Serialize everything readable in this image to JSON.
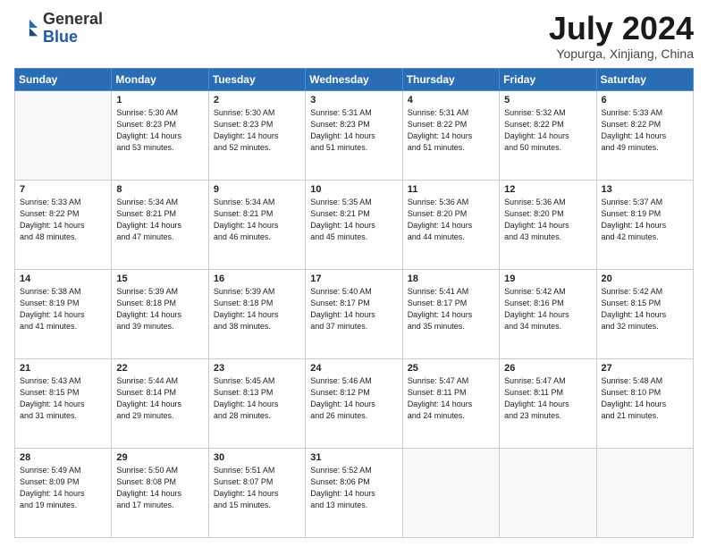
{
  "header": {
    "logo_general": "General",
    "logo_blue": "Blue",
    "title": "July 2024",
    "subtitle": "Yopurga, Xinjiang, China"
  },
  "calendar": {
    "days_of_week": [
      "Sunday",
      "Monday",
      "Tuesday",
      "Wednesday",
      "Thursday",
      "Friday",
      "Saturday"
    ],
    "weeks": [
      [
        {
          "day": "",
          "info": ""
        },
        {
          "day": "1",
          "info": "Sunrise: 5:30 AM\nSunset: 8:23 PM\nDaylight: 14 hours\nand 53 minutes."
        },
        {
          "day": "2",
          "info": "Sunrise: 5:30 AM\nSunset: 8:23 PM\nDaylight: 14 hours\nand 52 minutes."
        },
        {
          "day": "3",
          "info": "Sunrise: 5:31 AM\nSunset: 8:23 PM\nDaylight: 14 hours\nand 51 minutes."
        },
        {
          "day": "4",
          "info": "Sunrise: 5:31 AM\nSunset: 8:22 PM\nDaylight: 14 hours\nand 51 minutes."
        },
        {
          "day": "5",
          "info": "Sunrise: 5:32 AM\nSunset: 8:22 PM\nDaylight: 14 hours\nand 50 minutes."
        },
        {
          "day": "6",
          "info": "Sunrise: 5:33 AM\nSunset: 8:22 PM\nDaylight: 14 hours\nand 49 minutes."
        }
      ],
      [
        {
          "day": "7",
          "info": "Sunrise: 5:33 AM\nSunset: 8:22 PM\nDaylight: 14 hours\nand 48 minutes."
        },
        {
          "day": "8",
          "info": "Sunrise: 5:34 AM\nSunset: 8:21 PM\nDaylight: 14 hours\nand 47 minutes."
        },
        {
          "day": "9",
          "info": "Sunrise: 5:34 AM\nSunset: 8:21 PM\nDaylight: 14 hours\nand 46 minutes."
        },
        {
          "day": "10",
          "info": "Sunrise: 5:35 AM\nSunset: 8:21 PM\nDaylight: 14 hours\nand 45 minutes."
        },
        {
          "day": "11",
          "info": "Sunrise: 5:36 AM\nSunset: 8:20 PM\nDaylight: 14 hours\nand 44 minutes."
        },
        {
          "day": "12",
          "info": "Sunrise: 5:36 AM\nSunset: 8:20 PM\nDaylight: 14 hours\nand 43 minutes."
        },
        {
          "day": "13",
          "info": "Sunrise: 5:37 AM\nSunset: 8:19 PM\nDaylight: 14 hours\nand 42 minutes."
        }
      ],
      [
        {
          "day": "14",
          "info": "Sunrise: 5:38 AM\nSunset: 8:19 PM\nDaylight: 14 hours\nand 41 minutes."
        },
        {
          "day": "15",
          "info": "Sunrise: 5:39 AM\nSunset: 8:18 PM\nDaylight: 14 hours\nand 39 minutes."
        },
        {
          "day": "16",
          "info": "Sunrise: 5:39 AM\nSunset: 8:18 PM\nDaylight: 14 hours\nand 38 minutes."
        },
        {
          "day": "17",
          "info": "Sunrise: 5:40 AM\nSunset: 8:17 PM\nDaylight: 14 hours\nand 37 minutes."
        },
        {
          "day": "18",
          "info": "Sunrise: 5:41 AM\nSunset: 8:17 PM\nDaylight: 14 hours\nand 35 minutes."
        },
        {
          "day": "19",
          "info": "Sunrise: 5:42 AM\nSunset: 8:16 PM\nDaylight: 14 hours\nand 34 minutes."
        },
        {
          "day": "20",
          "info": "Sunrise: 5:42 AM\nSunset: 8:15 PM\nDaylight: 14 hours\nand 32 minutes."
        }
      ],
      [
        {
          "day": "21",
          "info": "Sunrise: 5:43 AM\nSunset: 8:15 PM\nDaylight: 14 hours\nand 31 minutes."
        },
        {
          "day": "22",
          "info": "Sunrise: 5:44 AM\nSunset: 8:14 PM\nDaylight: 14 hours\nand 29 minutes."
        },
        {
          "day": "23",
          "info": "Sunrise: 5:45 AM\nSunset: 8:13 PM\nDaylight: 14 hours\nand 28 minutes."
        },
        {
          "day": "24",
          "info": "Sunrise: 5:46 AM\nSunset: 8:12 PM\nDaylight: 14 hours\nand 26 minutes."
        },
        {
          "day": "25",
          "info": "Sunrise: 5:47 AM\nSunset: 8:11 PM\nDaylight: 14 hours\nand 24 minutes."
        },
        {
          "day": "26",
          "info": "Sunrise: 5:47 AM\nSunset: 8:11 PM\nDaylight: 14 hours\nand 23 minutes."
        },
        {
          "day": "27",
          "info": "Sunrise: 5:48 AM\nSunset: 8:10 PM\nDaylight: 14 hours\nand 21 minutes."
        }
      ],
      [
        {
          "day": "28",
          "info": "Sunrise: 5:49 AM\nSunset: 8:09 PM\nDaylight: 14 hours\nand 19 minutes."
        },
        {
          "day": "29",
          "info": "Sunrise: 5:50 AM\nSunset: 8:08 PM\nDaylight: 14 hours\nand 17 minutes."
        },
        {
          "day": "30",
          "info": "Sunrise: 5:51 AM\nSunset: 8:07 PM\nDaylight: 14 hours\nand 15 minutes."
        },
        {
          "day": "31",
          "info": "Sunrise: 5:52 AM\nSunset: 8:06 PM\nDaylight: 14 hours\nand 13 minutes."
        },
        {
          "day": "",
          "info": ""
        },
        {
          "day": "",
          "info": ""
        },
        {
          "day": "",
          "info": ""
        }
      ]
    ]
  }
}
